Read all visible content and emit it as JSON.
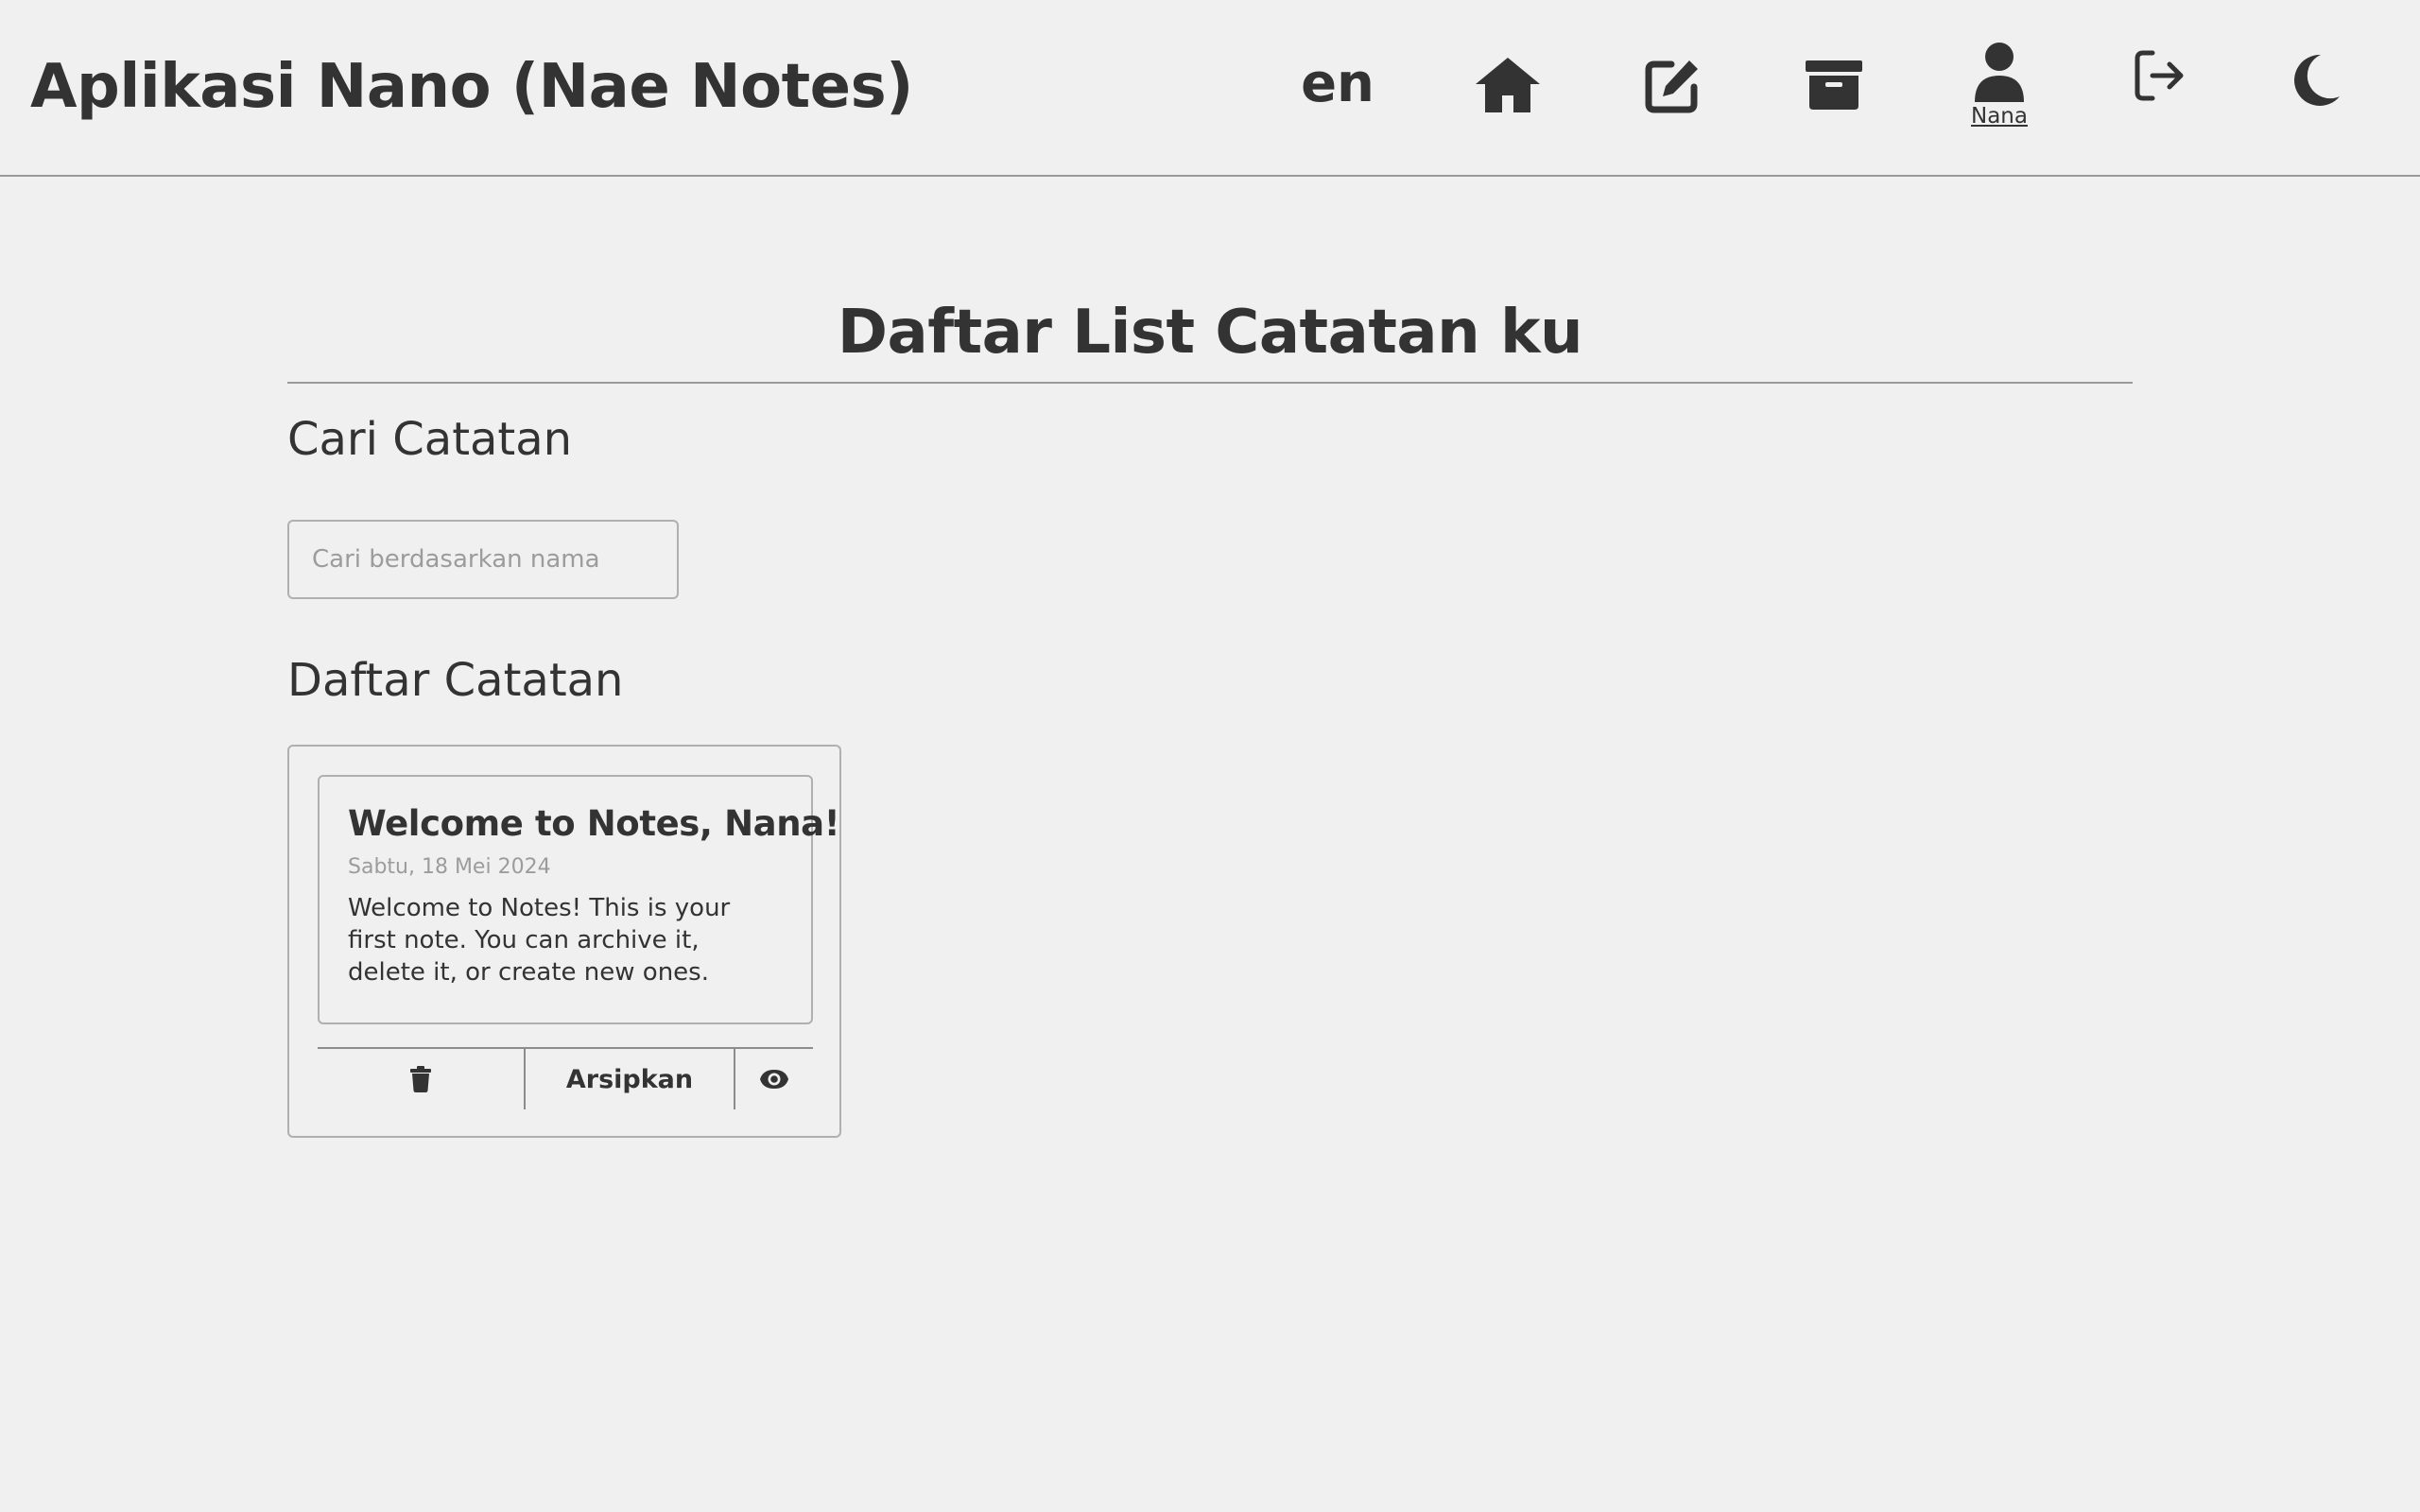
{
  "header": {
    "app_title": "Aplikasi Nano (Nae Notes)",
    "lang_toggle": "en",
    "nav_icons": [
      "home-icon",
      "edit-icon",
      "archive-box-icon",
      "user-icon",
      "logout-icon",
      "moon-icon"
    ],
    "profile_name": "Nana"
  },
  "main": {
    "page_title": "Daftar List Catatan ku",
    "search_title": "Cari Catatan",
    "search_placeholder": "Cari berdasarkan nama",
    "search_value": "",
    "list_title": "Daftar Catatan"
  },
  "notes": [
    {
      "title": "Welcome to Notes, Nana!",
      "date": "Sabtu, 18 Mei 2024",
      "body": "Welcome to Notes! This is your first note. You can archive it, delete it, or create new ones.",
      "actions": {
        "delete_icon": "trash-icon",
        "archive_label": "Arsipkan",
        "view_icon": "eye-icon"
      }
    }
  ],
  "colors": {
    "background": "#f0f0f0",
    "text": "#333333",
    "muted_text": "#9c9c9c",
    "border": "#b0b0b0"
  }
}
